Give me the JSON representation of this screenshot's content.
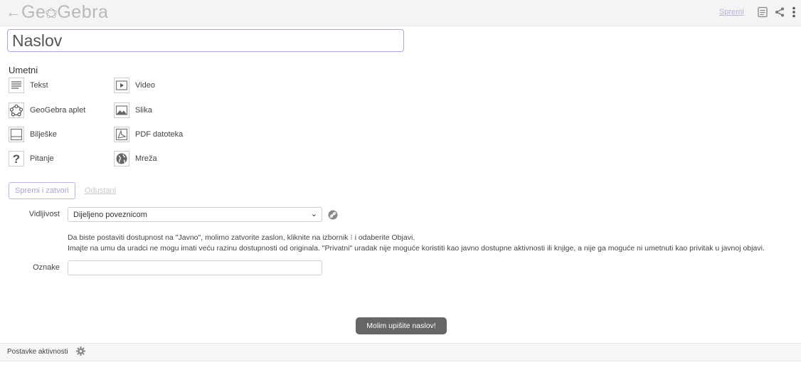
{
  "header": {
    "back_icon": "arrow-left-icon",
    "logo": "GeoGebra",
    "save_link": "Spremi",
    "icons": [
      "slides-icon",
      "share-icon",
      "more-vertical-icon"
    ]
  },
  "title_input": {
    "placeholder": "Naslov"
  },
  "insert": {
    "label": "Umetni",
    "items": [
      {
        "label": "Tekst",
        "icon": "text-icon"
      },
      {
        "label": "Video",
        "icon": "video-icon"
      },
      {
        "label": "GeoGebra aplet",
        "icon": "geogebra-applet-icon"
      },
      {
        "label": "Slika",
        "icon": "image-icon"
      },
      {
        "label": "Bilješke",
        "icon": "notes-icon"
      },
      {
        "label": "PDF datoteka",
        "icon": "pdf-icon"
      },
      {
        "label": "Pitanje",
        "icon": "question-icon"
      },
      {
        "label": "Mreža",
        "icon": "web-icon"
      }
    ]
  },
  "actions": {
    "save_close": "Spremi i zatvori",
    "cancel": "Odustani"
  },
  "visibility": {
    "label": "Vidljivost",
    "selected": "Dijeljeno poveznicom",
    "info_line1": "Da biste postaviti dostupnost na \"Javno\", molimo zatvorite zaslon, kliknite na izbornik ⁝ i odaberite Objavi.",
    "info_line2": "Imajte na umu da uradci ne mogu imati veću razinu dostupnosti od originala. \"Privatni\" uradak nije moguće koristiti kao javno dostupne aktivnosti ili knjige, a nije ga moguće ni umetnuti kao privitak u javnoj objavi."
  },
  "tags": {
    "label": "Oznake",
    "value": ""
  },
  "toast": "Molim upišite naslov!",
  "footer": {
    "label": "Postavke aktivnosti"
  }
}
